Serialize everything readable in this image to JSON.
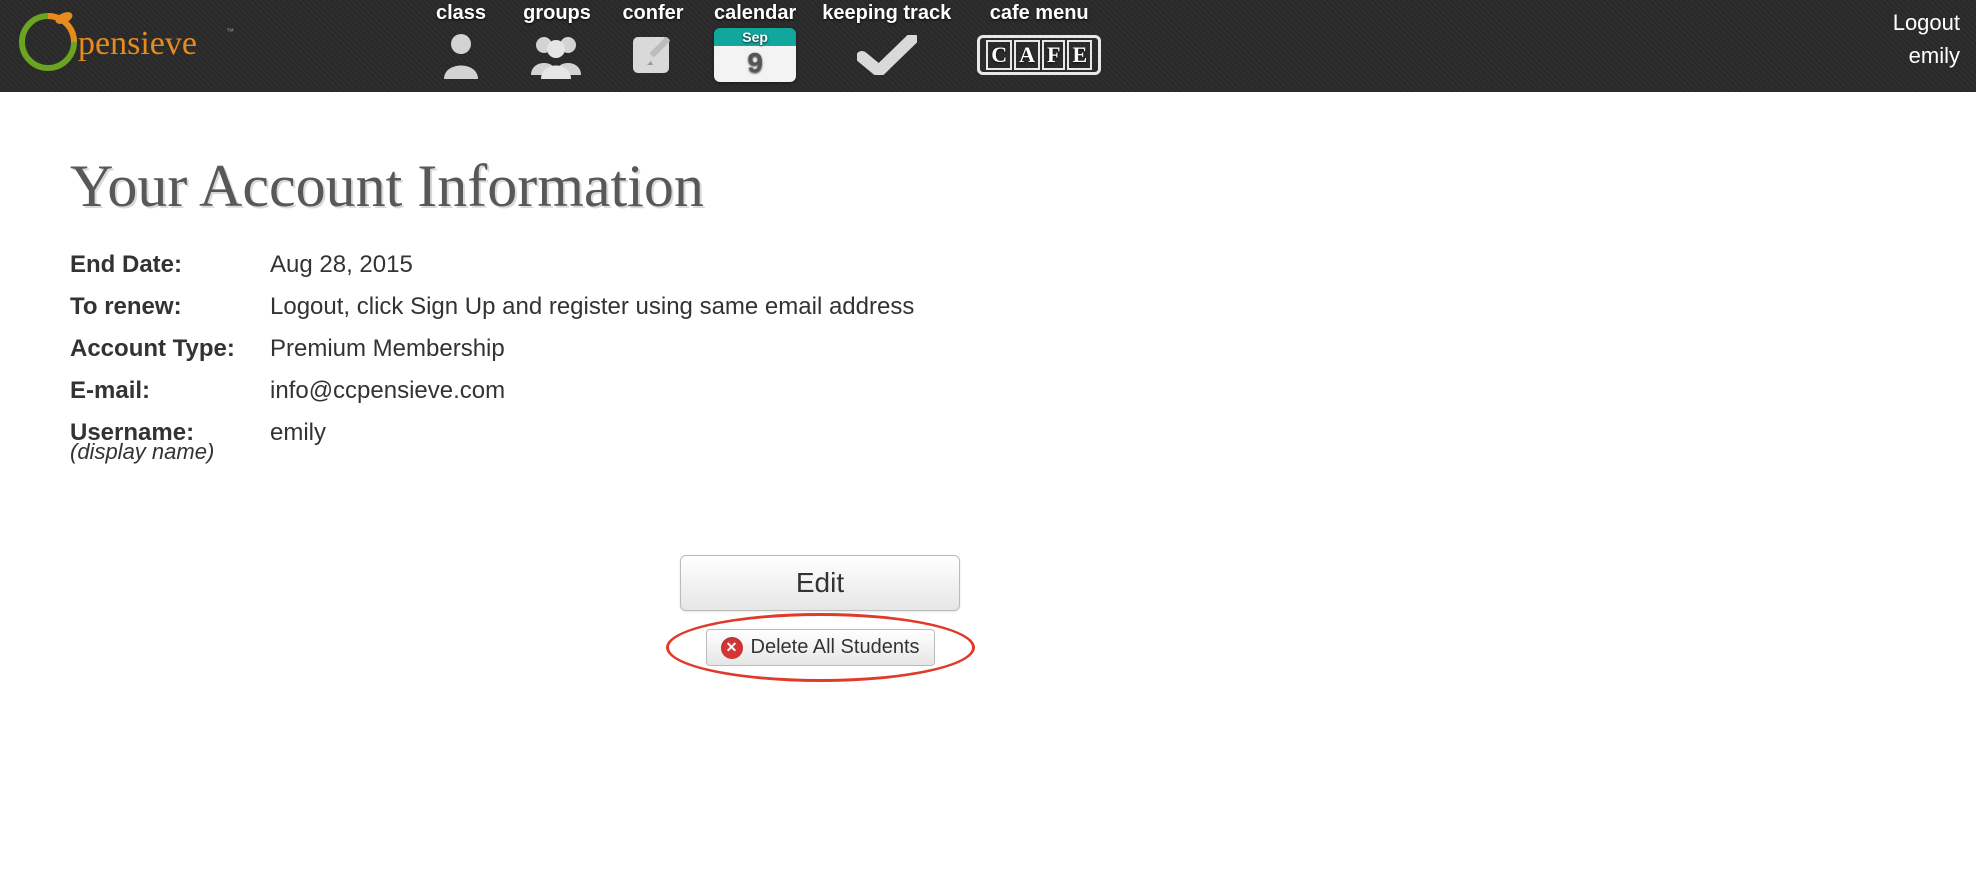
{
  "brand": "pensieve",
  "nav": {
    "items": [
      {
        "label": "class"
      },
      {
        "label": "groups"
      },
      {
        "label": "confer"
      },
      {
        "label": "calendar",
        "month": "Sep",
        "day": "9"
      },
      {
        "label": "keeping track"
      },
      {
        "label": "cafe menu"
      }
    ]
  },
  "user_menu": {
    "logout": "Logout",
    "username": "emily"
  },
  "page": {
    "title": "Your Account Information"
  },
  "account": {
    "end_date_label": "End Date:",
    "end_date": "Aug 28, 2015",
    "renew_label": "To renew:",
    "renew_text": "Logout, click Sign Up and register using same email address",
    "type_label": "Account Type:",
    "type": "Premium Membership",
    "email_label": "E-mail:",
    "email": "info@ccpensieve.com",
    "username_label": "Username:",
    "username": "emily",
    "username_note": "(display name)"
  },
  "actions": {
    "edit": "Edit",
    "delete_all": "Delete All Students"
  }
}
